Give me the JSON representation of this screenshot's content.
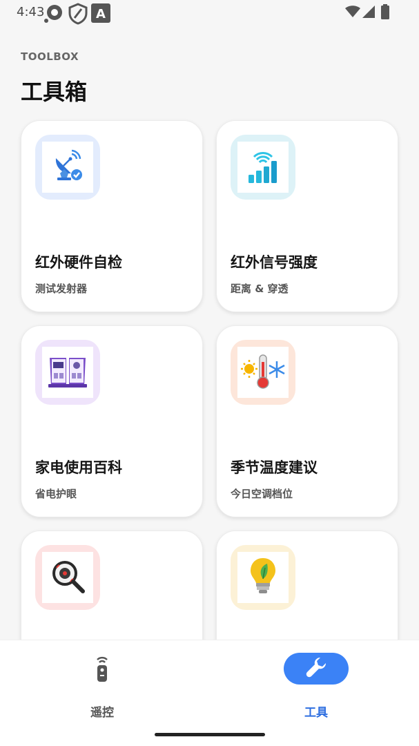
{
  "status_bar": {
    "time": "4:43",
    "icons": [
      "circle-notification-icon",
      "shield-icon",
      "a-notification-icon",
      "wifi-icon",
      "signal-icon",
      "battery-icon"
    ]
  },
  "header": {
    "eyebrow": "TOOLBOX",
    "title": "工具箱"
  },
  "tools": [
    {
      "title": "红外硬件自检",
      "subtitle": "测试发射器",
      "icon": "satellite-dish-icon",
      "tile_color": "#e3ecfd"
    },
    {
      "title": "红外信号强度",
      "subtitle": "距离 & 穿透",
      "icon": "signal-strength-icon",
      "tile_color": "#ddf2f7"
    },
    {
      "title": "家电使用百科",
      "subtitle": "省电护眼",
      "icon": "appliance-book-icon",
      "tile_color": "#efe4fb"
    },
    {
      "title": "季节温度建议",
      "subtitle": "今日空调档位",
      "icon": "thermometer-icon",
      "tile_color": "#fde6da"
    },
    {
      "title": "",
      "subtitle": "",
      "icon": "magnifier-icon",
      "tile_color": "#fde2e2"
    },
    {
      "title": "",
      "subtitle": "",
      "icon": "lightbulb-icon",
      "tile_color": "#fcf1d6"
    }
  ],
  "bottom_nav": {
    "items": [
      {
        "label": "遥控",
        "icon": "remote-control-icon",
        "active": false
      },
      {
        "label": "工具",
        "icon": "wrench-icon",
        "active": true
      }
    ],
    "accent": "#3b82f6"
  }
}
